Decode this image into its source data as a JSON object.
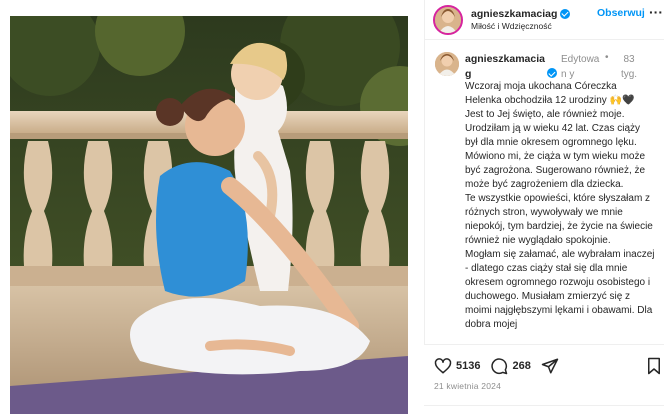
{
  "header": {
    "username": "agnieszkamaciag",
    "subtitle": "Miłość i Wdzięczność",
    "follow_label": "Obserwuj",
    "more_label": "···"
  },
  "post": {
    "username": "agnieszkamacia g",
    "edited_label": "Edytowan y",
    "separator": "•",
    "age": "83 tyg.",
    "caption": [
      "Wczoraj moja ukochana Córeczka Helenka obchodziła 12 urodziny 🙌🖤",
      "Jest to Jej święto, ale również moje. Urodziłam ją w wieku 42 lat. Czas ciąży był dla mnie okresem ogromnego lęku. Mówiono mi, że ciąża w tym wieku może być zagrożona. Sugerowano również, że może być zagrożeniem dla dziecka.",
      "Te wszystkie opowieści, które słyszałam z różnych stron, wywoływały we mnie niepokój, tym bardziej, że życie na świecie również nie wyglądało spokojnie.",
      "Mogłam się załamać, ale wybrałam inaczej - dlatego czas ciąży stał się dla mnie okresem ogromnego rozwoju osobistego i duchowego. Musiałam zmierzyć się z moimi najgłębszymi lękami i obawami. Dla dobra mojej"
    ]
  },
  "actions": {
    "likes": "5136",
    "comments": "268",
    "date": "21 kwietnia 2024"
  },
  "icons": {
    "like": "heart-icon",
    "comment": "comment-icon",
    "share": "send-icon",
    "save": "bookmark-icon",
    "verified": "verified-badge-icon"
  },
  "colors": {
    "follow": "#0095f6",
    "verified": "#0095f6",
    "secondary_text": "#8e8e8e"
  }
}
